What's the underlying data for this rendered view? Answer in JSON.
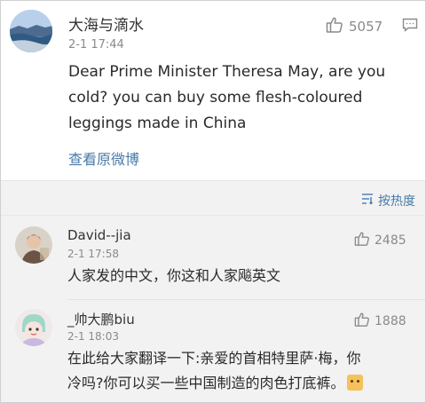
{
  "main_post": {
    "username": "大海与滴水",
    "time": "2-1 17:44",
    "like_count": "5057",
    "text": "Dear Prime Minister Theresa May, are you cold? you can buy some flesh-coloured leggings made in China",
    "view_original": "查看原微博"
  },
  "sort": {
    "label": "按热度"
  },
  "comments": [
    {
      "username": "David--jia",
      "time": "2-1 17:58",
      "like_count": "2485",
      "text": "人家发的中文，你这和人家飚英文"
    },
    {
      "username": "_帅大鹏biu",
      "time": "2-1 18:03",
      "like_count": "1888",
      "text_line1": "在此给大家翻译一下:亲爱的首相特里萨·梅，你",
      "text_line2": "冷吗?你可以买一些中国制造的肉色打底裤。"
    }
  ],
  "colors": {
    "link": "#4a7aa8",
    "meta": "#8a8a8a",
    "comment_bg": "#f2f2f2"
  }
}
